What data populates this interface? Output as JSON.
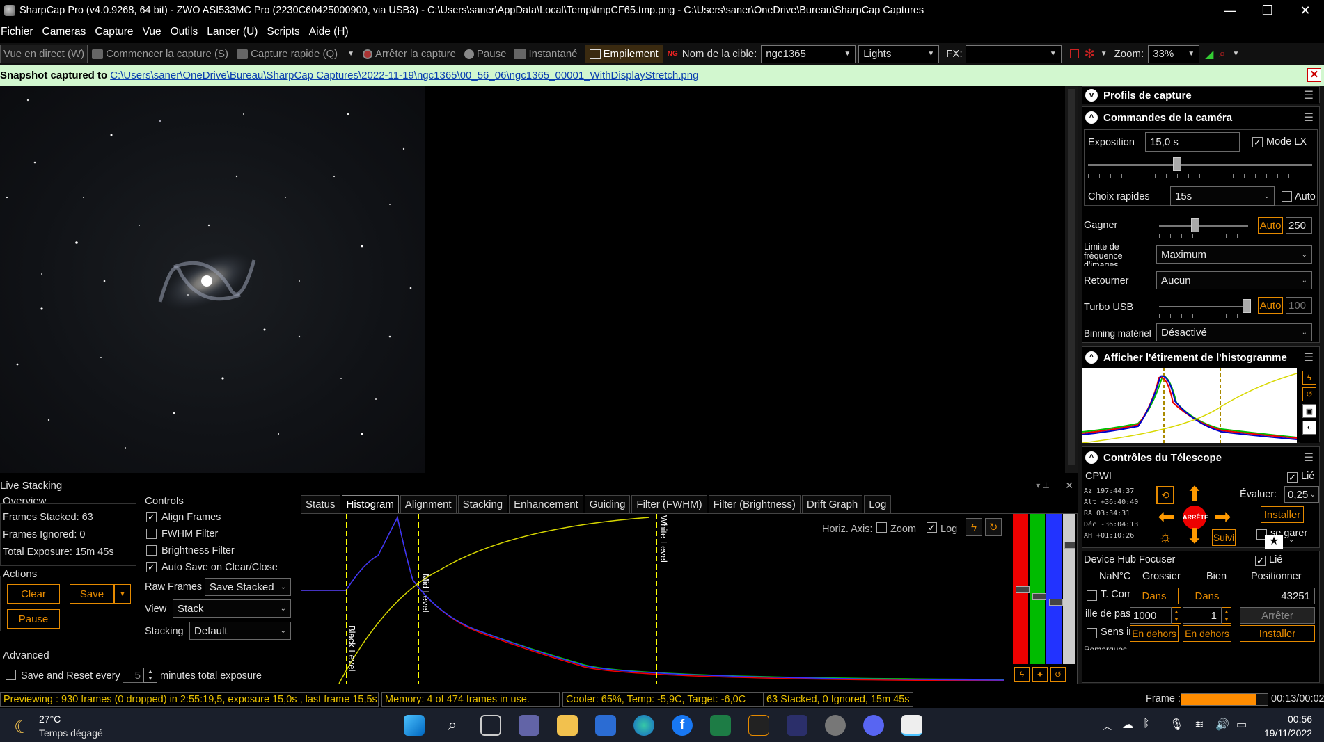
{
  "title_bar": {
    "title": "SharpCap Pro (v4.0.9268, 64 bit) - ZWO ASI533MC Pro (2230C60425000900, via USB3) - C:\\Users\\saner\\AppData\\Local\\Temp\\tmpCF65.tmp.png - C:\\Users\\saner\\OneDrive\\Bureau\\SharpCap Captures",
    "minimize": "—",
    "restore": "❐",
    "close": "✕"
  },
  "menu": [
    "Fichier",
    "Cameras",
    "Capture",
    "Vue",
    "Outils",
    "Lancer (U)",
    "Scripts",
    "Aide (H)"
  ],
  "toolbar": {
    "live_view": "Vue en direct (W)",
    "start_capture": "Commencer la capture (S)",
    "quick_capture": "Capture rapide (Q)",
    "stop_capture": "Arrêter la capture",
    "pause": "Pause",
    "snapshot": "Instantané",
    "stacking": "Empilement",
    "target_label": "Nom de la cible:",
    "target_value": "ngc1365",
    "frame_type": "Lights",
    "fx_label": "FX:",
    "fx_value": "",
    "zoom_label": "Zoom:",
    "zoom_value": "33%"
  },
  "snapshot_bar": {
    "prefix": "Snapshot captured to",
    "path": "C:\\Users\\saner\\OneDrive\\Bureau\\SharpCap Captures\\2022-11-19\\ngc1365\\00_56_06\\ngc1365_00001_WithDisplayStretch.png"
  },
  "right_panel": {
    "profiles_title": "Profils de capture",
    "camera_title": "Commandes de la caméra",
    "exposure_label": "Exposition",
    "exposure_value": "15,0 s",
    "lx_mode_label": "Mode LX",
    "quick_choice_label": "Choix rapides",
    "quick_choice_value": "15s",
    "auto_label": "Auto",
    "gain_label": "Gagner",
    "gain_auto": "Auto",
    "gain_value": "250",
    "frame_rate_label_1": "Limite de",
    "frame_rate_label_2": "fréquence",
    "frame_rate_label_3": "d'images",
    "frame_rate_value": "Maximum",
    "flip_label": "Retourner",
    "flip_value": "Aucun",
    "turbo_label": "Turbo USB",
    "turbo_auto": "Auto",
    "turbo_value": "100",
    "binning_label": "Binning matériel",
    "binning_value": "Désactivé",
    "histo_title": "Afficher l'étirement de l'histogramme",
    "telescope_title": "Contrôles du Télescope",
    "telescope_name": "CPWI",
    "telescope_linked": "Lié",
    "coords": {
      "az": "Az  197:44:37",
      "alt": "Alt +36:40:40",
      "ra": "RA  03:34:31",
      "dec": "Déc -36:04:13",
      "ah": "AH +01:10:26"
    },
    "rate_label": "Évaluer:",
    "rate_value": "0,25",
    "install_button": "Installer",
    "park_label": "se garer",
    "stop_button": "ARRÊTE",
    "track_button": "Suivi",
    "focuser_title": "Device Hub Focuser",
    "focuser_linked": "Lié",
    "temp_value": "NaN°C",
    "coarse_label": "Grossier",
    "fine_label": "Bien",
    "position_label": "Positionner",
    "tcomp_label": "T. Com",
    "in_coarse": "Dans",
    "in_fine": "Dans",
    "position_value": "43251",
    "step_label": "ille de pas",
    "step_coarse": "1000",
    "step_fine": "1",
    "stop_focus": "Arrêter",
    "direction_label": "Sens in",
    "out_coarse": "En dehors",
    "out_fine": "En dehors",
    "install_focus": "Installer",
    "remarks": "Remarques"
  },
  "live_stacking": {
    "title": "Live Stacking",
    "overview_title": "Overview",
    "frames_stacked": "Frames Stacked: 63",
    "frames_ignored": "Frames Ignored: 0",
    "total_exposure": "Total Exposure:   15m 45s",
    "actions_title": "Actions",
    "clear": "Clear",
    "save": "Save",
    "pause": "Pause",
    "advanced_title": "Advanced",
    "save_reset_label": "Save and Reset every",
    "save_reset_value": "5",
    "minutes_label": "minutes total exposure",
    "controls_title": "Controls",
    "align_frames": "Align Frames",
    "fwhm_filter": "FWHM Filter",
    "brightness_filter": "Brightness Filter",
    "auto_save": "Auto Save on Clear/Close",
    "raw_frames_label": "Raw Frames",
    "raw_frames_value": "Save Stacked",
    "view_label": "View",
    "view_value": "Stack",
    "stacking_label": "Stacking",
    "stacking_value": "Default",
    "tabs": [
      "Status",
      "Histogram",
      "Alignment",
      "Stacking",
      "Enhancement",
      "Guiding",
      "Filter (FWHM)",
      "Filter (Brightness)",
      "Drift Graph",
      "Log"
    ],
    "horiz_axis_label": "Horiz. Axis:",
    "zoom_label": "Zoom",
    "log_label": "Log",
    "black_level": "Black Level",
    "mid_level": "Mid Level",
    "white_level": "White Level"
  },
  "status_bar": {
    "preview": "Previewing : 930 frames (0 dropped) in 2:55:19,5, exposure 15,0s , last frame 15,5s",
    "memory": "Memory: 4 of 474 frames in use.",
    "cooler": "Cooler: 65%, Temp: -5,9C, Target: -6,0C",
    "stacked": "63 Stacked, 0 Ignored, 15m 45s",
    "frame_label": "Frame :",
    "frame_time": "00:13/00:02"
  },
  "taskbar": {
    "temperature": "27°C",
    "weather": "Temps dégagé",
    "time": "00:56",
    "date": "19/11/2022"
  },
  "colors": {
    "accent_orange": "#e58a00",
    "snap_green": "#d2f7cf",
    "status_yellow": "#e8c000",
    "link_blue": "#0a3fb0"
  }
}
